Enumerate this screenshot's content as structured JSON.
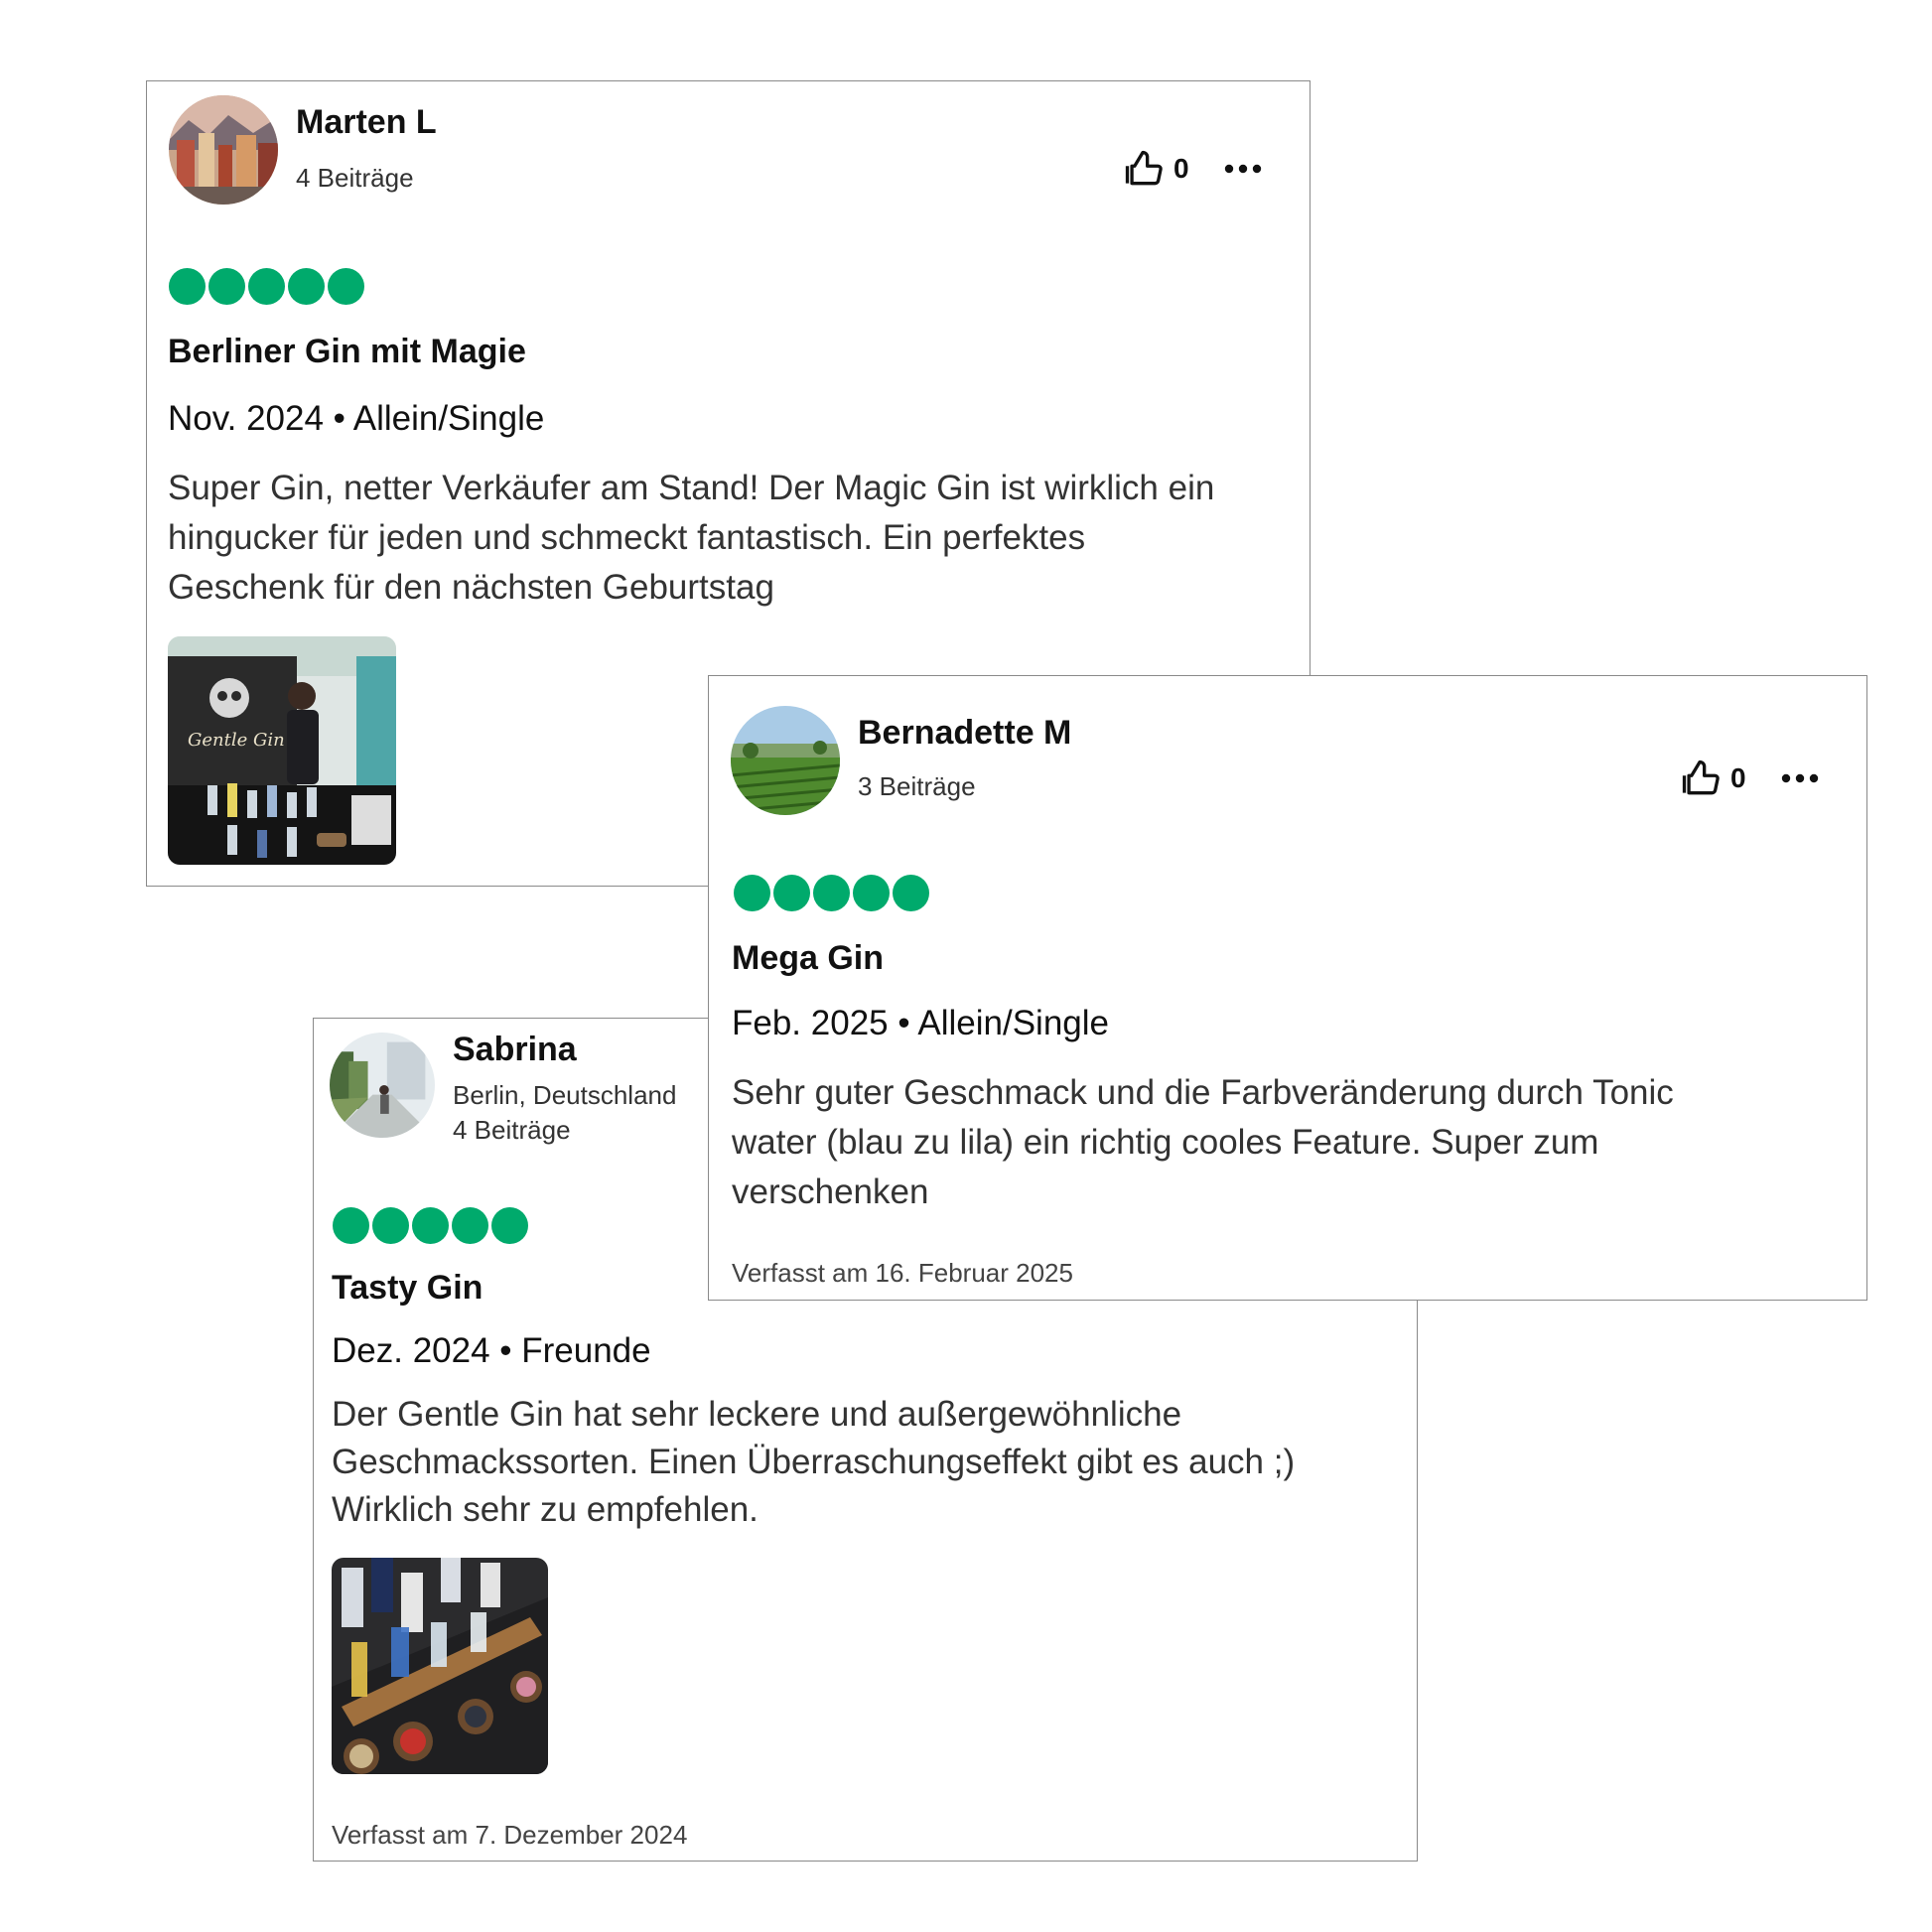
{
  "colors": {
    "rating_bubble": "#00aa6c",
    "border": "#8a8a8a",
    "text": "#111111"
  },
  "reviews": {
    "marten": {
      "name": "Marten L",
      "contributions": "4 Beiträge",
      "likes": "0",
      "rating": 5,
      "title": "Berliner Gin mit Magie",
      "meta": "Nov. 2024 • Allein/Single",
      "body": [
        "Super Gin, netter Verkäufer am Stand! Der Magic Gin ist wirklich ein",
        "hingucker für jeden und schmeckt fantastisch. Ein perfektes",
        "Geschenk für den nächsten Geburtstag"
      ],
      "photo_label": "Gentle Gin"
    },
    "bernadette": {
      "name": "Bernadette M",
      "contributions": "3 Beiträge",
      "likes": "0",
      "rating": 5,
      "title": "Mega Gin",
      "meta": "Feb. 2025 • Allein/Single",
      "body": [
        "Sehr guter Geschmack und die Farbveränderung durch Tonic",
        "water (blau zu lila) ein richtig cooles Feature. Super zum",
        "verschenken"
      ],
      "written": "Verfasst am 16. Februar 2025"
    },
    "sabrina": {
      "name": "Sabrina",
      "location": "Berlin, Deutschland",
      "contributions": "4 Beiträge",
      "rating": 5,
      "title": "Tasty Gin",
      "meta": "Dez. 2024 • Freunde",
      "body": [
        "Der Gentle Gin hat sehr leckere und außergewöhnliche",
        "Geschmackssorten. Einen Überraschungseffekt gibt es auch ;)",
        "Wirklich sehr zu empfehlen."
      ],
      "written": "Verfasst am 7. Dezember 2024"
    }
  }
}
